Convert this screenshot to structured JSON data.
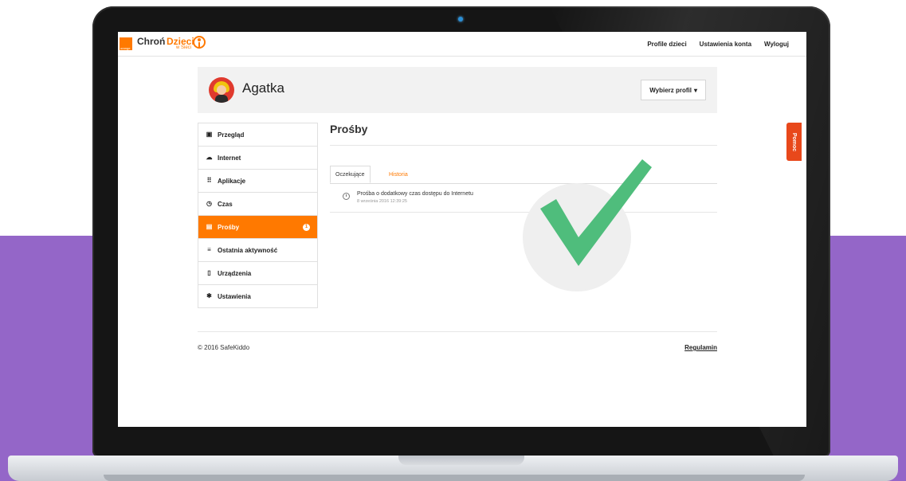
{
  "app": {
    "logo_chron": "Chroń",
    "logo_dzieci": "Dzieci",
    "logo_wsieci": "w Sieci",
    "brand_small": "orange",
    "accent_color": "#ff7900"
  },
  "topnav": {
    "items": [
      "Profile dzieci",
      "Ustawienia konta",
      "Wyloguj"
    ]
  },
  "profile": {
    "name": "Agatka",
    "select_label": "Wybierz profil",
    "select_caret": "▾"
  },
  "sidebar": {
    "items": [
      {
        "label": "Przegląd",
        "icon": "overview-icon",
        "glyph": "▣"
      },
      {
        "label": "Internet",
        "icon": "cloud-icon",
        "glyph": "☁"
      },
      {
        "label": "Aplikacje",
        "icon": "apps-grid-icon",
        "glyph": "⠿"
      },
      {
        "label": "Czas",
        "icon": "clock-icon",
        "glyph": "◷"
      },
      {
        "label": "Prośby",
        "icon": "message-icon",
        "glyph": "▤",
        "active": true,
        "badge": "1"
      },
      {
        "label": "Ostatnia aktywność",
        "icon": "list-icon",
        "glyph": "≡"
      },
      {
        "label": "Urządzenia",
        "icon": "phone-icon",
        "glyph": "▯"
      },
      {
        "label": "Ustawienia",
        "icon": "gear-icon",
        "glyph": "✱"
      }
    ]
  },
  "main": {
    "title": "Prośby",
    "tabs": [
      {
        "label": "Oczekujące",
        "active": true
      },
      {
        "label": "Historia",
        "active": false
      }
    ],
    "requests": [
      {
        "title": "Prośba o dodatkowy czas dostępu do Internetu",
        "date": "8 września 2016 12:39:25"
      }
    ]
  },
  "footer": {
    "copyright": "© 2016 SafeKiddo",
    "link": "Regulamin"
  },
  "help": {
    "label": "Pomoc"
  },
  "overlay": {
    "icon": "checkmark-icon",
    "color": "#4fbd7c"
  }
}
